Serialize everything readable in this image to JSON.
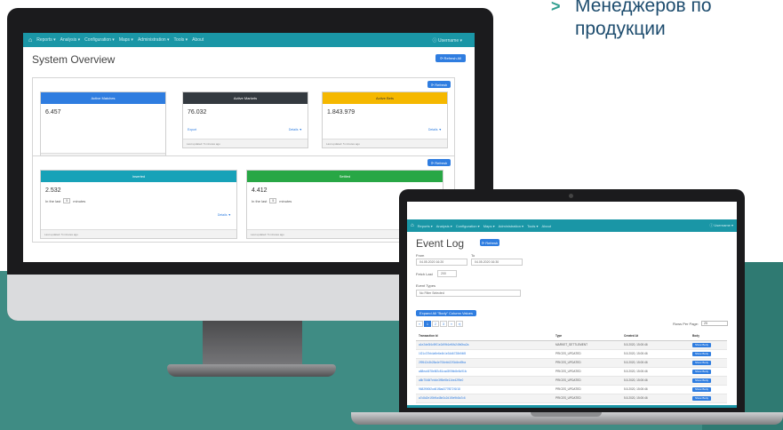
{
  "bullets": [
    {
      "text": "Менеджеров по"
    },
    {
      "text": "продукции"
    }
  ],
  "monitor": {
    "nav": {
      "items": [
        "Reports ▾",
        "Analysis ▾",
        "Configuration ▾",
        "Maps ▾",
        "Administration ▾",
        "Tools ▾",
        "About"
      ],
      "user": "ⓘ  Username ▾"
    },
    "title": "System Overview",
    "refresh_all": "⟳ Refresh All",
    "refresh": "⟳ Refresh",
    "cards_top": [
      {
        "header": "Active Matches",
        "value": "6.457",
        "footer": "Last updated: 5 minutes ago",
        "color": "#2f7de0",
        "head_text_color": "#ffffff"
      },
      {
        "header": "Active Markets",
        "value": "76.032",
        "export": "Export",
        "details": "Details ▼",
        "footer": "Last updated: 5 minutes ago",
        "color": "#343a40",
        "head_text_color": "#ffffff"
      },
      {
        "header": "Active Bets",
        "value": "1.843.979",
        "details": "Details ▼",
        "footer": "Last updated: 5 minutes ago",
        "color": "#f5b800",
        "head_text_color": "#333333"
      }
    ],
    "cards_bottom": [
      {
        "header": "Inserted",
        "value": "2.532",
        "inlast": "In the last",
        "minutes": "5",
        "unit": "minutes",
        "details": "Details ▼",
        "footer": "Last updated: 5 minutes ago",
        "color": "#17a2b8"
      },
      {
        "header": "Settled",
        "value": "4.412",
        "inlast": "In the last",
        "minutes": "5",
        "unit": "minutes",
        "footer": "Last updated: 5 minutes ago",
        "color": "#28a745"
      }
    ]
  },
  "laptop": {
    "nav": {
      "items": [
        "Reports ▾",
        "Analysis ▾",
        "Configuration ▾",
        "Maps ▾",
        "Administration ▾",
        "Tools ▾",
        "About"
      ],
      "user": "ⓘ  Username ▾"
    },
    "title": "Event Log",
    "refresh": "⟳ Refresh",
    "from_label": "From",
    "from_value": "04.05.2020 16:20",
    "to_label": "To",
    "to_value": "04.05.2020 16:30",
    "fetch_label": "Fetch Last",
    "fetch_value": "200",
    "event_types_label": "Event Types",
    "event_types_value": "No Filter Selected",
    "expand_all": "Expand All \"Body\" Column Values",
    "pages": [
      "«",
      "1",
      "2",
      "3",
      "»",
      "»|"
    ],
    "rows_per_page_label": "Rows Per Page:",
    "rows_per_page_value": "25",
    "columns": [
      "Transaction Id",
      "Type",
      "Created At",
      "Body"
    ],
    "rows": [
      {
        "id": "a1e2de3f4c9f01e2d9fb1ef6fc24fb0ba2a",
        "type": "MARKET_SETTLEMENT",
        "created": "5.5.2020, 15:00:46",
        "body": "Show Body"
      },
      {
        "id": "1f21c37bb4a9e6e4b1e34d6728b94f8",
        "type": "PRICES_UPDATED",
        "created": "5.5.2020, 15:00:46",
        "body": "Show Body"
      },
      {
        "id": "2f9542c3b28a4e706ebb22f3d4ed9ba",
        "type": "PRICES_UPDATED",
        "created": "5.5.2020, 15:00:46",
        "body": "Show Body"
      },
      {
        "id": "a88ea4678e8f2c81cad3f0fbb8e8c91fc",
        "type": "PRICES_UPDATED",
        "created": "5.5.2020, 15:00:46",
        "body": "Show Body"
      },
      {
        "id": "a8b7546f7eb4e3ff5ef8e11be42f9e0",
        "type": "PRICES_UPDATED",
        "created": "5.5.2020, 15:00:46",
        "body": "Show Body"
      },
      {
        "id": "9682f5f0f2cd61f8ad377f872f1f18",
        "type": "PRICES_UPDATED",
        "created": "5.5.2020, 15:00:46",
        "body": "Show Body"
      },
      {
        "id": "a7c8d2e1f0b9a48e3c2d1f0e9b8a7c6",
        "type": "PRICES_UPDATED",
        "created": "5.5.2020, 15:00:46",
        "body": "Show Body"
      }
    ]
  }
}
